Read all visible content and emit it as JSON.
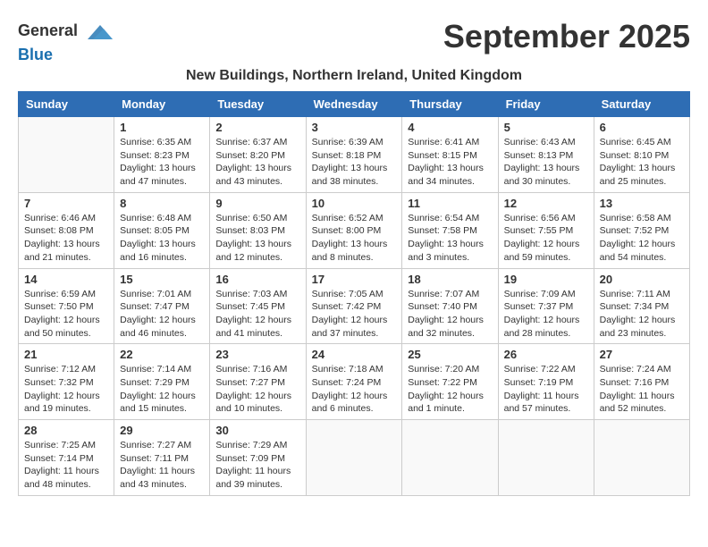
{
  "logo": {
    "general": "General",
    "blue": "Blue"
  },
  "title": "September 2025",
  "subtitle": "New Buildings, Northern Ireland, United Kingdom",
  "days_of_week": [
    "Sunday",
    "Monday",
    "Tuesday",
    "Wednesday",
    "Thursday",
    "Friday",
    "Saturday"
  ],
  "weeks": [
    [
      {
        "day": "",
        "info": ""
      },
      {
        "day": "1",
        "info": "Sunrise: 6:35 AM\nSunset: 8:23 PM\nDaylight: 13 hours\nand 47 minutes."
      },
      {
        "day": "2",
        "info": "Sunrise: 6:37 AM\nSunset: 8:20 PM\nDaylight: 13 hours\nand 43 minutes."
      },
      {
        "day": "3",
        "info": "Sunrise: 6:39 AM\nSunset: 8:18 PM\nDaylight: 13 hours\nand 38 minutes."
      },
      {
        "day": "4",
        "info": "Sunrise: 6:41 AM\nSunset: 8:15 PM\nDaylight: 13 hours\nand 34 minutes."
      },
      {
        "day": "5",
        "info": "Sunrise: 6:43 AM\nSunset: 8:13 PM\nDaylight: 13 hours\nand 30 minutes."
      },
      {
        "day": "6",
        "info": "Sunrise: 6:45 AM\nSunset: 8:10 PM\nDaylight: 13 hours\nand 25 minutes."
      }
    ],
    [
      {
        "day": "7",
        "info": "Sunrise: 6:46 AM\nSunset: 8:08 PM\nDaylight: 13 hours\nand 21 minutes."
      },
      {
        "day": "8",
        "info": "Sunrise: 6:48 AM\nSunset: 8:05 PM\nDaylight: 13 hours\nand 16 minutes."
      },
      {
        "day": "9",
        "info": "Sunrise: 6:50 AM\nSunset: 8:03 PM\nDaylight: 13 hours\nand 12 minutes."
      },
      {
        "day": "10",
        "info": "Sunrise: 6:52 AM\nSunset: 8:00 PM\nDaylight: 13 hours\nand 8 minutes."
      },
      {
        "day": "11",
        "info": "Sunrise: 6:54 AM\nSunset: 7:58 PM\nDaylight: 13 hours\nand 3 minutes."
      },
      {
        "day": "12",
        "info": "Sunrise: 6:56 AM\nSunset: 7:55 PM\nDaylight: 12 hours\nand 59 minutes."
      },
      {
        "day": "13",
        "info": "Sunrise: 6:58 AM\nSunset: 7:52 PM\nDaylight: 12 hours\nand 54 minutes."
      }
    ],
    [
      {
        "day": "14",
        "info": "Sunrise: 6:59 AM\nSunset: 7:50 PM\nDaylight: 12 hours\nand 50 minutes."
      },
      {
        "day": "15",
        "info": "Sunrise: 7:01 AM\nSunset: 7:47 PM\nDaylight: 12 hours\nand 46 minutes."
      },
      {
        "day": "16",
        "info": "Sunrise: 7:03 AM\nSunset: 7:45 PM\nDaylight: 12 hours\nand 41 minutes."
      },
      {
        "day": "17",
        "info": "Sunrise: 7:05 AM\nSunset: 7:42 PM\nDaylight: 12 hours\nand 37 minutes."
      },
      {
        "day": "18",
        "info": "Sunrise: 7:07 AM\nSunset: 7:40 PM\nDaylight: 12 hours\nand 32 minutes."
      },
      {
        "day": "19",
        "info": "Sunrise: 7:09 AM\nSunset: 7:37 PM\nDaylight: 12 hours\nand 28 minutes."
      },
      {
        "day": "20",
        "info": "Sunrise: 7:11 AM\nSunset: 7:34 PM\nDaylight: 12 hours\nand 23 minutes."
      }
    ],
    [
      {
        "day": "21",
        "info": "Sunrise: 7:12 AM\nSunset: 7:32 PM\nDaylight: 12 hours\nand 19 minutes."
      },
      {
        "day": "22",
        "info": "Sunrise: 7:14 AM\nSunset: 7:29 PM\nDaylight: 12 hours\nand 15 minutes."
      },
      {
        "day": "23",
        "info": "Sunrise: 7:16 AM\nSunset: 7:27 PM\nDaylight: 12 hours\nand 10 minutes."
      },
      {
        "day": "24",
        "info": "Sunrise: 7:18 AM\nSunset: 7:24 PM\nDaylight: 12 hours\nand 6 minutes."
      },
      {
        "day": "25",
        "info": "Sunrise: 7:20 AM\nSunset: 7:22 PM\nDaylight: 12 hours\nand 1 minute."
      },
      {
        "day": "26",
        "info": "Sunrise: 7:22 AM\nSunset: 7:19 PM\nDaylight: 11 hours\nand 57 minutes."
      },
      {
        "day": "27",
        "info": "Sunrise: 7:24 AM\nSunset: 7:16 PM\nDaylight: 11 hours\nand 52 minutes."
      }
    ],
    [
      {
        "day": "28",
        "info": "Sunrise: 7:25 AM\nSunset: 7:14 PM\nDaylight: 11 hours\nand 48 minutes."
      },
      {
        "day": "29",
        "info": "Sunrise: 7:27 AM\nSunset: 7:11 PM\nDaylight: 11 hours\nand 43 minutes."
      },
      {
        "day": "30",
        "info": "Sunrise: 7:29 AM\nSunset: 7:09 PM\nDaylight: 11 hours\nand 39 minutes."
      },
      {
        "day": "",
        "info": ""
      },
      {
        "day": "",
        "info": ""
      },
      {
        "day": "",
        "info": ""
      },
      {
        "day": "",
        "info": ""
      }
    ]
  ]
}
